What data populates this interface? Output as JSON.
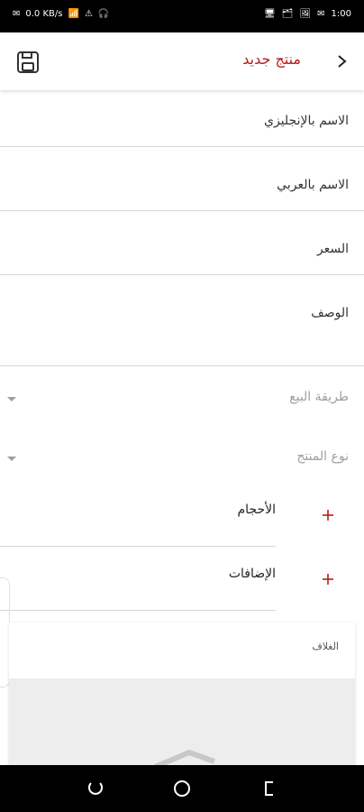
{
  "status_bar": {
    "left_items": [
      "✉",
      "0.0 KB/s",
      "📶",
      "⚠",
      "🎧"
    ],
    "right_items": [
      "🖥",
      "🗂",
      "🖼",
      "✉",
      "1:00"
    ]
  },
  "app_bar": {
    "title": "منتج جديد",
    "back_icon": "chevron-right-icon",
    "save_icon": "save-icon"
  },
  "form": {
    "english_name_label": "الاسم بالإنجليزي",
    "arabic_name_label": "الاسم بالعربي",
    "price_label": "السعر",
    "description_label": "الوصف"
  },
  "dropdowns": {
    "sale_method_label": "طريقة البيع",
    "product_type_label": "نوع المنتج"
  },
  "sections": {
    "sizes_label": "الأحجام",
    "addons_label": "الإضافات"
  },
  "cover": {
    "label": "الغلاف"
  },
  "colors": {
    "accent": "#b71c1c",
    "divider": "#d6d6d6",
    "muted": "#9e9e9e"
  }
}
